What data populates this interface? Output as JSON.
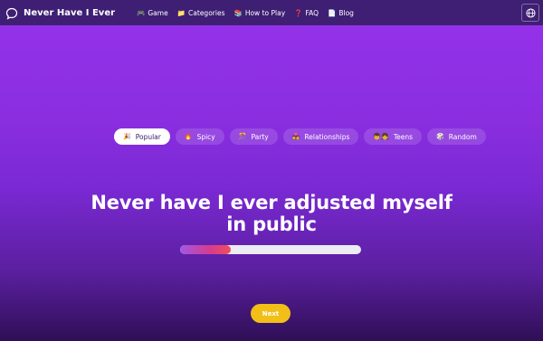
{
  "header": {
    "title": "Never Have I Ever",
    "brand_icon": "speech-bubble-icon",
    "nav": [
      {
        "label": "Game",
        "icon": "gamepad-icon",
        "glyph": "🎮"
      },
      {
        "label": "Categories",
        "icon": "folder-icon",
        "glyph": "📁"
      },
      {
        "label": "How to Play",
        "icon": "book-icon",
        "glyph": "📚"
      },
      {
        "label": "FAQ",
        "icon": "question-icon",
        "glyph": "❓"
      },
      {
        "label": "Blog",
        "icon": "document-icon",
        "glyph": "📄"
      }
    ],
    "language_icon": "globe-icon"
  },
  "categories": [
    {
      "label": "Popular",
      "icon": "party-popper-icon",
      "glyph": "🎉",
      "active": true
    },
    {
      "label": "Spicy",
      "icon": "fire-icon",
      "glyph": "🔥",
      "active": false
    },
    {
      "label": "Party",
      "icon": "confetti-icon",
      "glyph": "🎊",
      "active": false
    },
    {
      "label": "Relationships",
      "icon": "couple-icon",
      "glyph": "💑",
      "active": false
    },
    {
      "label": "Teens",
      "icon": "teens-icon",
      "glyph": "👦👧",
      "active": false
    },
    {
      "label": "Random",
      "icon": "dice-icon",
      "glyph": "🎲",
      "active": false
    }
  ],
  "question": {
    "text": "Never have I ever adjusted myself in public"
  },
  "progress": {
    "value": 0.28
  },
  "actions": {
    "next_label": "Next"
  },
  "colors": {
    "topbar": "#3e1f73",
    "background_top": "#9632ec",
    "background_bottom": "#2f0f56",
    "next_button": "#f2bf18",
    "active_chip": "#ffffff"
  }
}
